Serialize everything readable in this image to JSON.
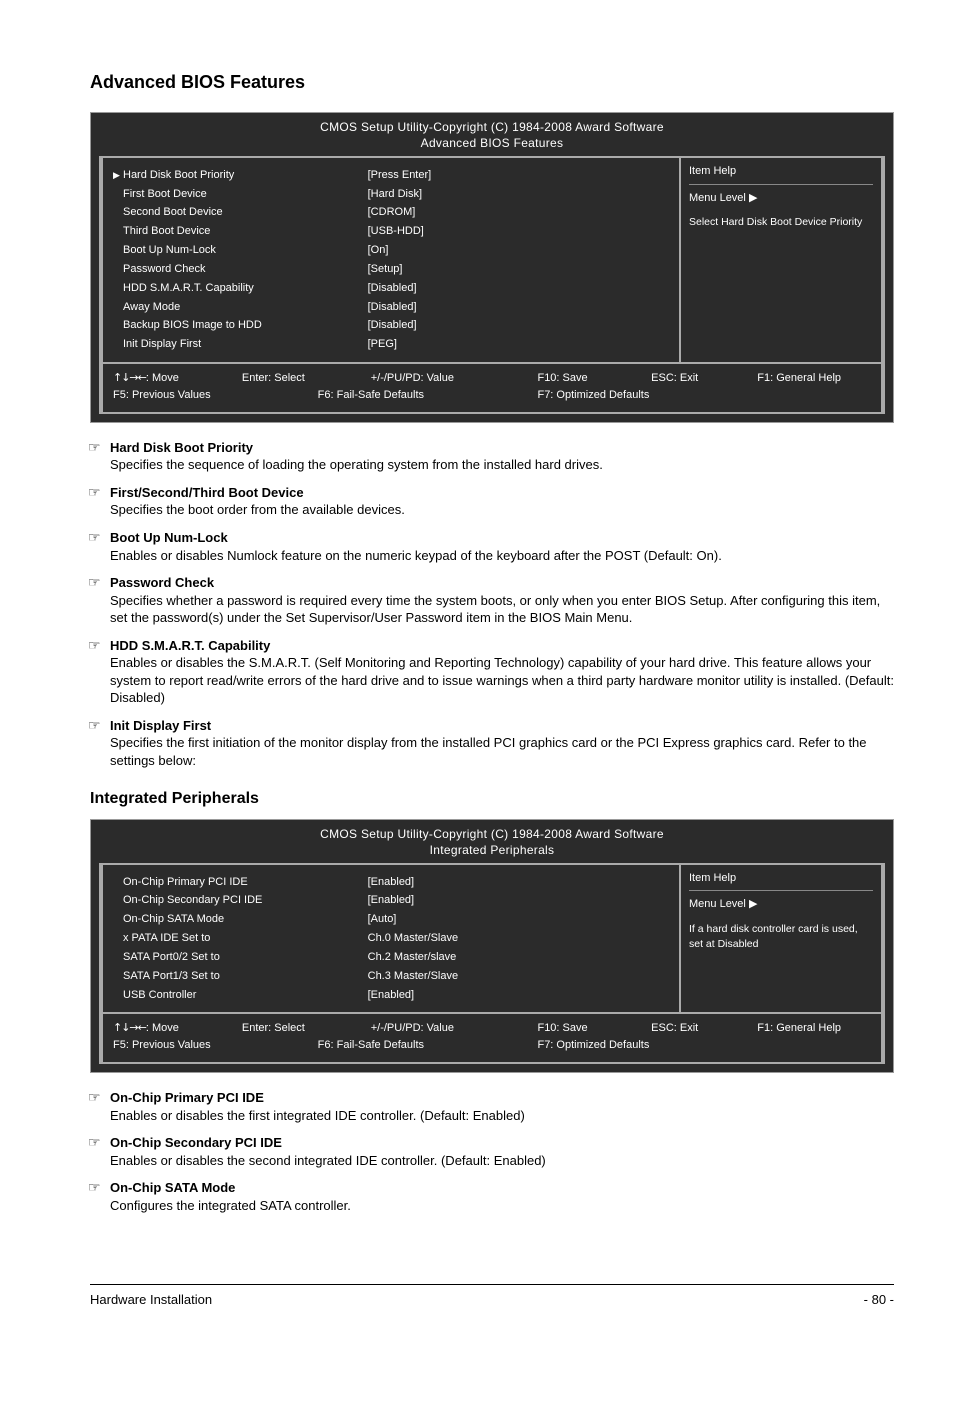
{
  "page_title": "Advanced BIOS Features",
  "bios1": {
    "utility_title": "CMOS Setup Utility-Copyright (C) 1984-2008 Award Software",
    "section_title": "Advanced BIOS Features",
    "rows": [
      {
        "arrow": true,
        "label": "Hard Disk Boot Priority",
        "value": "[Press Enter]",
        "selected": true
      },
      {
        "arrow": false,
        "label": "First Boot Device",
        "value": "[Hard Disk]"
      },
      {
        "arrow": false,
        "label": "Second Boot Device",
        "value": "[CDROM]"
      },
      {
        "arrow": false,
        "label": "Third Boot Device",
        "value": "[USB-HDD]"
      },
      {
        "arrow": false,
        "label": "Boot Up Num-Lock",
        "value": "[On]"
      },
      {
        "arrow": false,
        "label": "Password Check",
        "value": "[Setup]"
      },
      {
        "arrow": false,
        "label": "HDD S.M.A.R.T. Capability",
        "value": "[Disabled]"
      },
      {
        "arrow": false,
        "label": "Away Mode",
        "value": "[Disabled]"
      },
      {
        "arrow": false,
        "label": "Backup BIOS Image to HDD",
        "value": "[Disabled]"
      },
      {
        "arrow": false,
        "label": "Init Display First",
        "value": "[PEG]"
      }
    ],
    "help": {
      "title": "Item Help",
      "menu_level": "Menu Level",
      "body": "Select Hard Disk Boot Device Priority"
    },
    "footer": {
      "c1": ": Move",
      "c2": "Enter: Select",
      "c3": "+/-/PU/PD: Value",
      "c4": "F10: Save",
      "c5": "ESC: Exit",
      "c6": "F1: General Help",
      "c7": "F5: Previous Values",
      "c8": "F6: Fail-Safe Defaults",
      "c9": "F7: Optimized Defaults"
    }
  },
  "bullets": [
    {
      "lead": "Hard Disk Boot Priority",
      "text": "Specifies the sequence of loading the operating system from the installed hard drives."
    },
    {
      "lead": "First/Second/Third Boot Device",
      "text": "Specifies the boot order from the available devices."
    },
    {
      "lead": "Boot Up Num-Lock",
      "text": "Enables or disables Numlock feature on the numeric keypad of the keyboard after the POST (Default: On)."
    },
    {
      "lead": "Password Check",
      "text": "Specifies whether a password is required every time the system boots, or only when you enter BIOS Setup. After configuring this item, set the password(s) under the Set Supervisor/User Password item in the BIOS Main Menu."
    },
    {
      "lead": "HDD S.M.A.R.T. Capability",
      "text": "Enables or disables the S.M.A.R.T. (Self Monitoring and Reporting Technology) capability of your hard drive. This feature allows your system to report read/write errors of the hard drive and to issue warnings when a third party hardware monitor utility is installed. (Default: Disabled)"
    },
    {
      "lead": "Init Display First",
      "text": "Specifies the first initiation of the monitor display from the installed PCI graphics card or the PCI Express graphics card. Refer to the settings below:"
    }
  ],
  "section_heading": "Integrated Peripherals",
  "bios2": {
    "utility_title": "CMOS Setup Utility-Copyright (C) 1984-2008 Award Software",
    "section_title": "Integrated Peripherals",
    "rows": [
      {
        "arrow": false,
        "label": "On-Chip Primary PCI IDE",
        "value": "[Enabled]"
      },
      {
        "arrow": false,
        "label": "On-Chip Secondary PCI IDE",
        "value": "[Enabled]"
      },
      {
        "arrow": false,
        "label": "On-Chip SATA Mode",
        "value": "[Auto]"
      },
      {
        "arrow": false,
        "label": "x    PATA IDE Set to",
        "value": "Ch.0 Master/Slave"
      },
      {
        "arrow": false,
        "label": "SATA Port0/2 Set to",
        "value": "Ch.2 Master/slave"
      },
      {
        "arrow": false,
        "label": "SATA Port1/3 Set to",
        "value": "Ch.3 Master/Slave"
      },
      {
        "arrow": false,
        "label": "USB Controller",
        "value": "[Enabled]"
      }
    ],
    "help": {
      "title": "Item Help",
      "menu_level": "Menu Level",
      "body": "If a hard disk controller card is used, set at Disabled"
    },
    "footer": {
      "c1": ": Move",
      "c2": "Enter: Select",
      "c3": "+/-/PU/PD: Value",
      "c4": "F10: Save",
      "c5": "ESC: Exit",
      "c6": "F1: General Help",
      "c7": "F5: Previous Values",
      "c8": "F6: Fail-Safe Defaults",
      "c9": "F7: Optimized Defaults"
    }
  },
  "bullets2": [
    {
      "lead": "On-Chip Primary PCI IDE",
      "text": "Enables or disables the first integrated IDE controller. (Default: Enabled)"
    },
    {
      "lead": "On-Chip Secondary PCI IDE",
      "text": "Enables or disables the second integrated IDE controller. (Default: Enabled)"
    },
    {
      "lead": "On-Chip SATA Mode",
      "text": "Configures the integrated SATA controller."
    }
  ],
  "footer": {
    "left": "Hardware Installation",
    "right": "- 80 -"
  }
}
